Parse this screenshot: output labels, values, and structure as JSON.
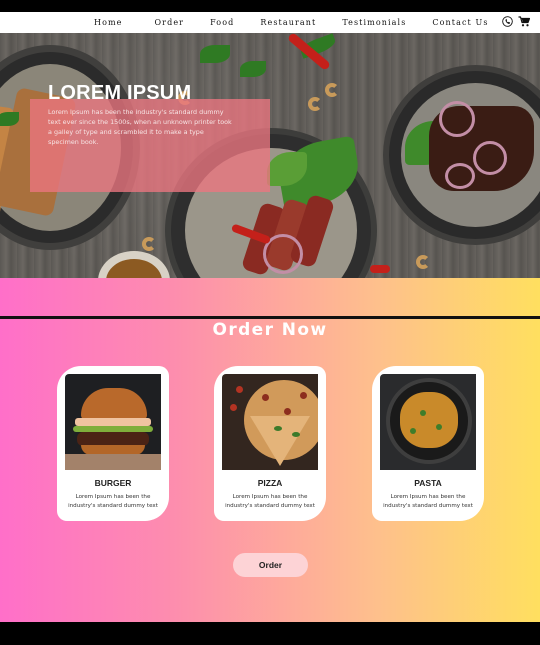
{
  "nav": {
    "links": [
      "Home",
      "Order",
      "Food",
      "Restaurant",
      "Testimonials",
      "Contact Us"
    ],
    "icons": [
      "phone-icon",
      "cart-icon"
    ]
  },
  "hero": {
    "title": "LOREM IPSUM",
    "text": "Lorem Ipsum has been the industry's standard dummy text ever since the 1500s, when an unknown printer took a galley of type and scrambled it to make a type specimen book."
  },
  "order": {
    "title": "Order Now",
    "cards": [
      {
        "name": "BURGER",
        "desc": "Lorem Ipsum has been the industry's standard dummy text"
      },
      {
        "name": "PIZZA",
        "desc": "Lorem Ipsum has been the industry's standard dummy text"
      },
      {
        "name": "PASTA",
        "desc": "Lorem Ipsum has been the industry's standard dummy text"
      }
    ],
    "button_label": "Order"
  },
  "colors": {
    "gradient_start": "#ff6fc9",
    "gradient_end": "#ffdf5f",
    "overlay": "#ec7680",
    "button": "#fdd3d6"
  }
}
